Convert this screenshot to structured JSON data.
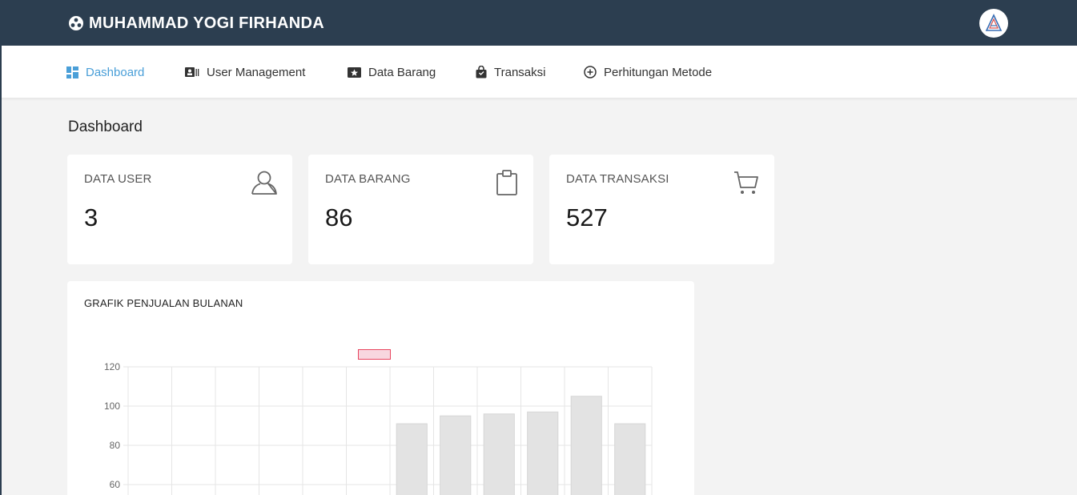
{
  "header": {
    "brand": "MUHAMMAD YOGI FIRHANDA",
    "brand_icon": "settings-circle-icon",
    "avatar_icon": "logo-avatar-icon",
    "bg_color": "#2c3e50"
  },
  "nav": {
    "items": [
      {
        "label": "Dashboard",
        "icon": "dashboard-grid-icon",
        "active": true
      },
      {
        "label": "User Management",
        "icon": "id-card-icon",
        "active": false
      },
      {
        "label": "Data Barang",
        "icon": "box-star-icon",
        "active": false
      },
      {
        "label": "Transaksi",
        "icon": "shopping-bag-icon",
        "active": false
      },
      {
        "label": "Perhitungan Metode",
        "icon": "plus-circle-icon",
        "active": false
      }
    ],
    "active_color": "#4a9fd8"
  },
  "page": {
    "title": "Dashboard"
  },
  "cards": [
    {
      "label": "DATA USER",
      "value": "3",
      "icon": "user-icon"
    },
    {
      "label": "DATA BARANG",
      "value": "86",
      "icon": "clipboard-bag-icon"
    },
    {
      "label": "DATA TRANSAKSI",
      "value": "527",
      "icon": "cart-icon"
    }
  ],
  "chart": {
    "title": "GRAFIK PENJUALAN BULANAN"
  },
  "chart_data": {
    "type": "bar",
    "title": "GRAFIK PENJUALAN BULANAN",
    "categories": [
      "",
      "",
      "",
      "",
      "",
      "",
      "",
      "",
      "",
      "",
      "",
      ""
    ],
    "series": [
      {
        "values": [
          null,
          null,
          null,
          null,
          null,
          null,
          91,
          95,
          96,
          97,
          105,
          91
        ],
        "color": "#e3e3e3"
      }
    ],
    "legend": {
      "visible": true,
      "position": "top",
      "swatch_color": "#f8d7df",
      "swatch_border": "#e8455f"
    },
    "yticks": [
      60,
      80,
      100,
      120
    ],
    "ylim": [
      40,
      120
    ],
    "grid": true,
    "xlabel": "",
    "ylabel": ""
  }
}
